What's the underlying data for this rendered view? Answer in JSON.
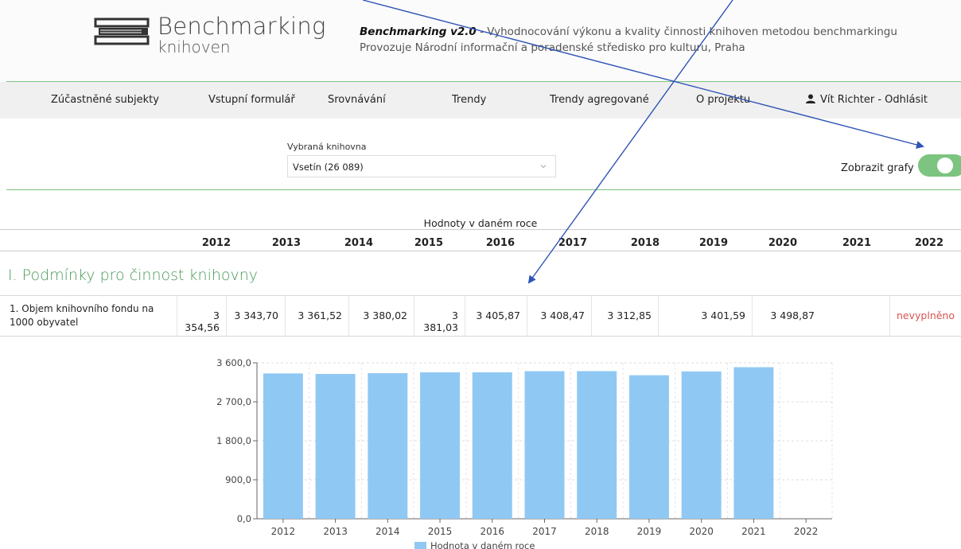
{
  "header": {
    "logo_title": "Benchmarking",
    "logo_sub": "knihoven",
    "app_name": "Benchmarking v2.0",
    "tagline": " - Vyhodnocování výkonu a kvality činnosti knihoven metodou benchmarkingu",
    "operator": "Provozuje Národní informační a poradenské středisko pro kulturu, Praha"
  },
  "nav": {
    "items": [
      {
        "label": "Zúčastněné subjekty"
      },
      {
        "label": "Vstupní formulář"
      },
      {
        "label": "Srovnávání"
      },
      {
        "label": "Trendy"
      },
      {
        "label": "Trendy agregované"
      },
      {
        "label": "O projektu"
      }
    ],
    "user": "Vít Richter - Odhlásit"
  },
  "library_select": {
    "label": "Vybraná knihovna",
    "value": "Vsetín (26 089)"
  },
  "toggle": {
    "label": "Zobrazit grafy",
    "on": true,
    "color": "#7cc47f"
  },
  "table": {
    "caption": "Hodnoty v daném roce",
    "years": [
      "2012",
      "2013",
      "2014",
      "2015",
      "2016",
      "2017",
      "2018",
      "2019",
      "2020",
      "2021",
      "2022"
    ],
    "section_title": "I. Podmínky pro činnost knihovny",
    "row": {
      "label": "1. Objem knihovního fondu na 1000 obyvatel",
      "values": [
        "3 354,56",
        "3 343,70",
        "3 361,52",
        "3 380,02",
        "3 381,03",
        "3 405,87",
        "3 408,47",
        "3 312,85",
        "3 401,59",
        "3 498,87",
        "nevyplněno"
      ]
    }
  },
  "chart_data": {
    "type": "bar",
    "categories": [
      "2012",
      "2013",
      "2014",
      "2015",
      "2016",
      "2017",
      "2018",
      "2019",
      "2020",
      "2021",
      "2022"
    ],
    "values": [
      3354.56,
      3343.7,
      3361.52,
      3380.02,
      3381.03,
      3405.87,
      3408.47,
      3312.85,
      3401.59,
      3498.87,
      null
    ],
    "ylim": [
      0,
      3600
    ],
    "yticks": [
      "0,0",
      "900,0",
      "1 800,0",
      "2 700,0",
      "3 600,0"
    ],
    "series": [
      {
        "name": "Hodnota v daném roce",
        "color": "#90c8f4"
      }
    ],
    "grid": true,
    "legend": "bottom"
  },
  "colors": {
    "accent": "#7cc47f",
    "section": "#4a9a5a",
    "missing": "#d9534f",
    "arrow": "#2f54b5"
  }
}
